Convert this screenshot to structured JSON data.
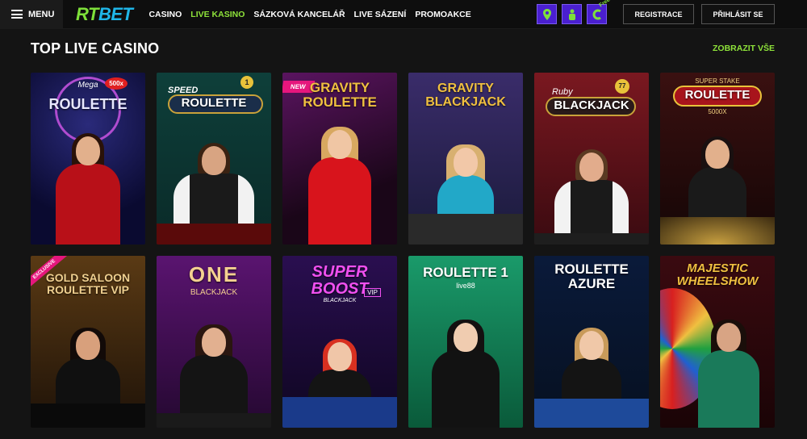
{
  "header": {
    "menu_label": "MENU",
    "logo_part1": "RT",
    "logo_part2": "BET",
    "nav": [
      "CASINO",
      "LIVE KASINO",
      "SÁZKOVÁ KANCELÁŘ",
      "LIVE SÁZENÍ",
      "PROMOAKCE"
    ],
    "active_nav": "LIVE KASINO",
    "icon_free_label": "Free",
    "register_label": "REGISTRACE",
    "login_label": "PŘIHLÁSIT SE"
  },
  "section": {
    "title": "TOP LIVE CASINO",
    "show_all": "ZOBRAZIT VŠE"
  },
  "games": [
    {
      "title": "ROULETTE",
      "pre": "Mega",
      "tag": "500x",
      "sub": ""
    },
    {
      "title": "ROULETTE",
      "pre": "SPEED",
      "tag": "1",
      "sub": ""
    },
    {
      "title": "GRAVITY ROULETTE",
      "pre": "",
      "tag": "NEW",
      "sub": ""
    },
    {
      "title": "GRAVITY BLACKJACK",
      "pre": "",
      "tag": "",
      "sub": ""
    },
    {
      "title": "BLACKJACK",
      "pre": "Ruby",
      "tag": "77",
      "sub": ""
    },
    {
      "title": "ROULETTE",
      "pre": "SUPER STAKE",
      "tag": "",
      "sub": "5000X"
    },
    {
      "title": "GOLD SALOON ROULETTE VIP",
      "pre": "",
      "tag": "EXCLUSIVE",
      "sub": ""
    },
    {
      "title": "ONE",
      "pre": "",
      "tag": "",
      "sub": "BLACKJACK"
    },
    {
      "title": "SUPER BOOST",
      "pre": "",
      "tag": "VIP",
      "sub": "BLACKJACK"
    },
    {
      "title": "ROULETTE 1",
      "pre": "",
      "tag": "",
      "sub": "live88"
    },
    {
      "title": "ROULETTE AZURE",
      "pre": "",
      "tag": "",
      "sub": ""
    },
    {
      "title": "MAJESTIC WHEELSHOW",
      "pre": "",
      "tag": "",
      "sub": ""
    }
  ]
}
